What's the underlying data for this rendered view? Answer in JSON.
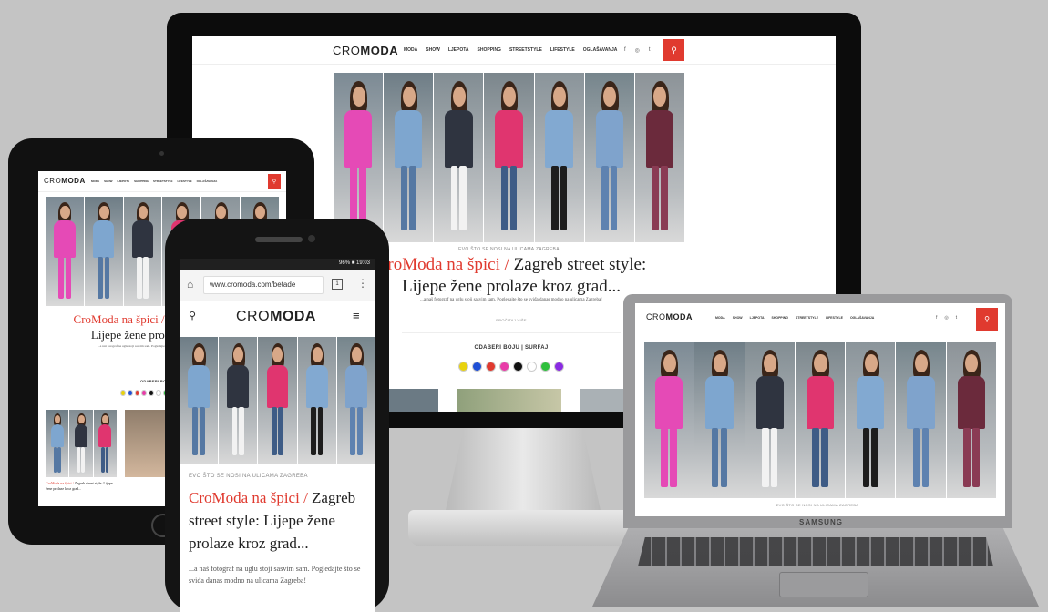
{
  "site": {
    "logo_light": "CRO",
    "logo_bold": "MODA",
    "nav": [
      "Moda",
      "Show",
      "Ljepota",
      "Shopping",
      "Streetstyle",
      "Lifestyle",
      "Oglašavanja"
    ],
    "social": [
      "f",
      "◎",
      "t"
    ],
    "headline_red": "CroModa na špici /",
    "headline_black": "Zagreb street style: Lijepe žene prolaze kroz grad...",
    "caption": "Evo što se nosi na ulicama Zagreba",
    "excerpt": "...a naš fotograf na uglu stoji sasvim sam. Pogledajte što se sviđa danas modno na ulicama Zagreba!",
    "read_more": "Pročitaj više",
    "color_filter_label": "Odaberi boju | Surfaj",
    "color_dots": [
      "#e8d20e",
      "#1f4fd6",
      "#e03a2f",
      "#e83ca8",
      "#111111",
      "#ffffff",
      "#2fbf3c",
      "#8a2be2"
    ]
  },
  "phone": {
    "status": "96% ■ 19:03",
    "url": "www.cromoda.com/betade",
    "tabs_count": "1"
  },
  "laptop": {
    "brand": "SAMSUNG"
  },
  "photos": [
    {
      "bg": "#7c8a94",
      "top": "#e54ab6",
      "legs": "#e54ab6"
    },
    {
      "bg": "#6e7d86",
      "top": "#7ea6cf",
      "legs": "#5578a3"
    },
    {
      "bg": "#828d93",
      "top": "#2f3440",
      "legs": "#f2f2f2"
    },
    {
      "bg": "#7b868c",
      "top": "#e0356f",
      "legs": "#3e5c86"
    },
    {
      "bg": "#8a949a",
      "top": "#82a9d1",
      "legs": "#1d1d1d"
    },
    {
      "bg": "#76858c",
      "top": "#7fa3cc",
      "legs": "#5e82b0"
    },
    {
      "bg": "#8c9398",
      "top": "#6b2a3c",
      "legs": "#8a3b54"
    }
  ]
}
